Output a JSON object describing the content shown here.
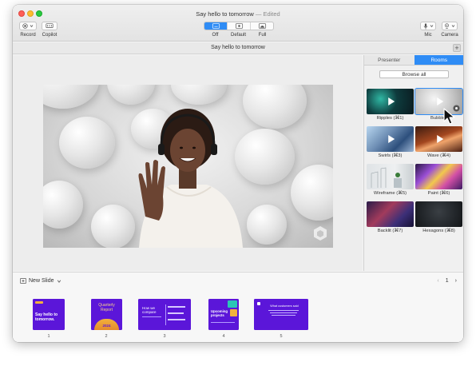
{
  "window": {
    "title": "Say hello to tomorrow",
    "title_suffix": " — Edited"
  },
  "toolbar": {
    "record_label": "Record",
    "copilot_label": "Copilot",
    "presenter_modes": [
      "Off",
      "Default",
      "Full"
    ],
    "active_mode": "Off",
    "mic_label": "Mic",
    "camera_label": "Camera"
  },
  "doc_bar": {
    "title": "Say hello to tomorrow",
    "add_label": "+"
  },
  "panel": {
    "tabs": [
      "Presenter",
      "Rooms"
    ],
    "active_tab": "Rooms",
    "browse_label": "Browse all",
    "rooms": [
      {
        "label": "Ripples (⌘1)",
        "icon": "play-icon"
      },
      {
        "label": "Bubbles",
        "icon": "play-icon",
        "selected": true
      },
      {
        "label": "Swirls (⌘3)",
        "icon": "play-icon"
      },
      {
        "label": "Wave (⌘4)",
        "icon": "play-icon"
      },
      {
        "label": "Wireframe (⌘5)"
      },
      {
        "label": "Paint (⌘6)"
      },
      {
        "label": "Backlit (⌘7)"
      },
      {
        "label": "Hexagons (⌘8)"
      }
    ]
  },
  "strip": {
    "new_slide_label": "New Slide",
    "page_current": "1",
    "slides": [
      {
        "number": "1",
        "text": "Say hello to tomorrow."
      },
      {
        "number": "2",
        "text": "Quarterly Report",
        "year": "2024"
      },
      {
        "number": "3",
        "text": "How we compare"
      },
      {
        "number": "4",
        "text": "Upcoming projects"
      },
      {
        "number": "5",
        "text": "What customers said"
      }
    ]
  },
  "colors": {
    "accent": "#2f8cf5",
    "slide_purple": "#5b16d9"
  }
}
